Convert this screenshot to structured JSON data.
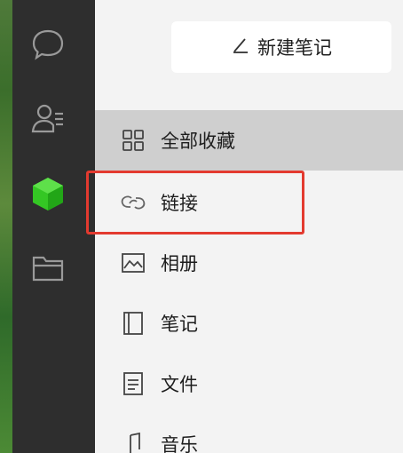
{
  "toolbar": {
    "new_note_label": "新建笔记",
    "new_note_icon": "pencil-icon"
  },
  "rail": {
    "icons": [
      "chat-icon",
      "contacts-icon",
      "favorites-cube-icon",
      "folder-icon"
    ],
    "active_color": "#34c724"
  },
  "menu": {
    "items": [
      {
        "label": "全部收藏",
        "icon": "grid-icon",
        "active": true
      },
      {
        "label": "链接",
        "icon": "link-icon",
        "active": false,
        "highlighted": true
      },
      {
        "label": "相册",
        "icon": "image-icon",
        "active": false
      },
      {
        "label": "笔记",
        "icon": "notebook-icon",
        "active": false
      },
      {
        "label": "文件",
        "icon": "document-icon",
        "active": false
      },
      {
        "label": "音乐",
        "icon": "music-icon",
        "active": false
      }
    ]
  },
  "colors": {
    "highlight": "#e33a2f",
    "active_row": "#cfcfcf",
    "rail": "#2e2e2e"
  }
}
